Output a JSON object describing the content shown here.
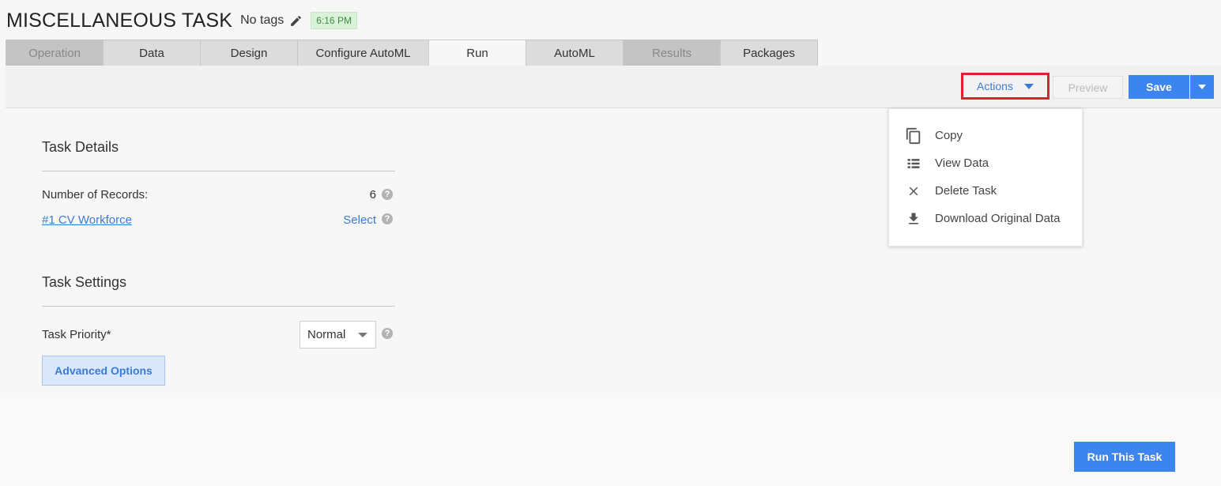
{
  "header": {
    "title": "MISCELLANEOUS TASK",
    "tags": "No tags",
    "time": "6:16 PM"
  },
  "tabs": [
    {
      "label": "Operation",
      "state": "disabled"
    },
    {
      "label": "Data",
      "state": "normal"
    },
    {
      "label": "Design",
      "state": "normal"
    },
    {
      "label": "Configure AutoML",
      "state": "normal"
    },
    {
      "label": "Run",
      "state": "active"
    },
    {
      "label": "AutoML",
      "state": "normal"
    },
    {
      "label": "Results",
      "state": "disabled"
    },
    {
      "label": "Packages",
      "state": "normal"
    }
  ],
  "toolbar": {
    "actions_label": "Actions",
    "preview_label": "Preview",
    "save_label": "Save"
  },
  "actions_menu": {
    "items": [
      {
        "label": "Copy",
        "icon": "copy-icon"
      },
      {
        "label": "View Data",
        "icon": "list-icon"
      },
      {
        "label": "Delete Task",
        "icon": "close-icon"
      },
      {
        "label": "Download Original Data",
        "icon": "download-icon"
      }
    ]
  },
  "task_details": {
    "title": "Task Details",
    "records_label": "Number of Records:",
    "records_value": "6",
    "dataset_link": "#1 CV Workforce",
    "select_label": "Select"
  },
  "task_settings": {
    "title": "Task Settings",
    "priority_label": "Task Priority*",
    "priority_value": "Normal",
    "advanced_label": "Advanced Options"
  },
  "footer": {
    "run_label": "Run This Task"
  },
  "colors": {
    "accent": "#3d85ee",
    "link": "#3b7bd4",
    "highlight_border": "#d9232e",
    "time_badge_bg": "#d9f2d9"
  }
}
